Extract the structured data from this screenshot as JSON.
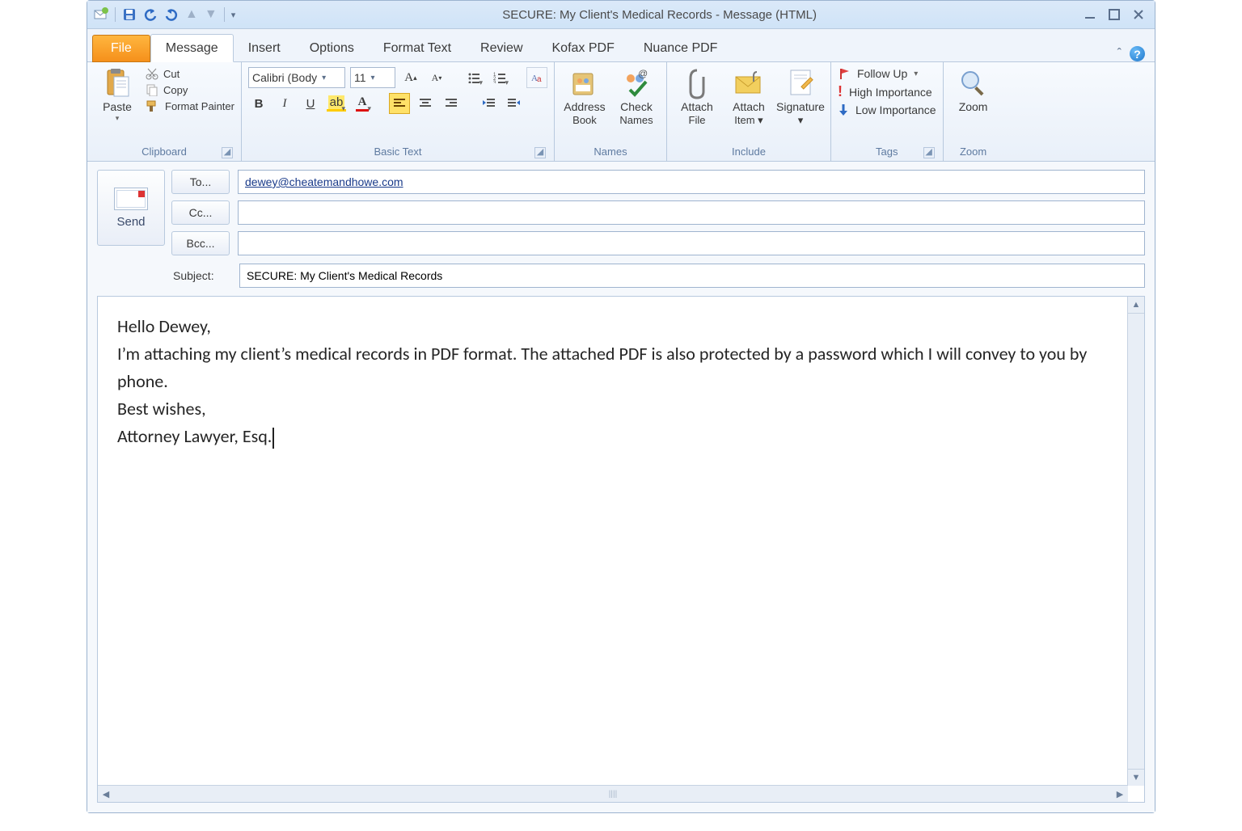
{
  "window": {
    "title": "SECURE: My Client's Medical Records  -  Message (HTML)"
  },
  "tabs": {
    "file": "File",
    "items": [
      "Message",
      "Insert",
      "Options",
      "Format Text",
      "Review",
      "Kofax PDF",
      "Nuance PDF"
    ],
    "active": 0
  },
  "ribbon": {
    "clipboard": {
      "label": "Clipboard",
      "paste": "Paste",
      "cut": "Cut",
      "copy": "Copy",
      "fmt": "Format Painter"
    },
    "basictext": {
      "label": "Basic Text",
      "font": "Calibri (Body",
      "size": "11"
    },
    "names": {
      "label": "Names",
      "ab_l1": "Address",
      "ab_l2": "Book",
      "cn_l1": "Check",
      "cn_l2": "Names"
    },
    "include": {
      "label": "Include",
      "af_l1": "Attach",
      "af_l2": "File",
      "ai_l1": "Attach",
      "ai_l2": "Item",
      "sig": "Signature"
    },
    "tags": {
      "label": "Tags",
      "follow": "Follow Up",
      "hi": "High Importance",
      "lo": "Low Importance"
    },
    "zoom": {
      "label": "Zoom",
      "btn": "Zoom"
    }
  },
  "compose": {
    "send": "Send",
    "to_btn": "To...",
    "cc_btn": "Cc...",
    "bcc_btn": "Bcc...",
    "to_val": "dewey@cheatemandhowe.com",
    "cc_val": "",
    "bcc_val": "",
    "subject_label": "Subject:",
    "subject_val": "SECURE: My Client's Medical Records",
    "body_lines": [
      "Hello Dewey,",
      "I’m attaching my client’s medical records in PDF format. The attached PDF is also protected by a password which I will convey to you by phone.",
      "Best wishes,",
      "Attorney Lawyer, Esq."
    ]
  }
}
